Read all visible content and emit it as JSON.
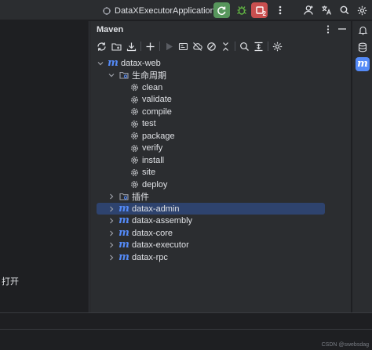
{
  "titlebar": {
    "run_config": "DataXExecutorApplication",
    "stop_count": "2",
    "icons": [
      "run-config-icon",
      "chevron-down-icon",
      "rerun-icon",
      "debug-icon",
      "stop-icon",
      "more-vertical-icon",
      "user-icon",
      "translate-icon",
      "search-icon",
      "settings-icon"
    ]
  },
  "editor": {
    "text": "打开"
  },
  "maven": {
    "title": "Maven",
    "toolbar_icons": [
      "reload-icon",
      "add-folder-icon",
      "download-icon",
      "plus-icon",
      "run-icon",
      "toggle-offline-icon",
      "skip-tests-icon",
      "no-icon",
      "collapse-icon",
      "analyze-dependencies-icon",
      "show-diagram-icon",
      "settings-icon"
    ],
    "tree": {
      "root": "datax-web",
      "lifecycle_label": "生命周期",
      "lifecycle": [
        "clean",
        "validate",
        "compile",
        "test",
        "package",
        "verify",
        "install",
        "site",
        "deploy"
      ],
      "plugins_label": "插件",
      "modules": [
        "datax-admin",
        "datax-assembly",
        "datax-core",
        "datax-executor",
        "datax-rpc"
      ],
      "selected": "datax-admin"
    }
  },
  "right_strip": {
    "icons": [
      "notifications-icon",
      "database-icon",
      "maven-icon"
    ]
  },
  "watermark": "CSDN @swebsdag",
  "colors": {
    "accent": "#548af7",
    "run": "#57965c",
    "stop": "#c94f4f",
    "selection": "#2e436e",
    "panel_bg": "#2b2d30",
    "editor_bg": "#1e1f22"
  }
}
